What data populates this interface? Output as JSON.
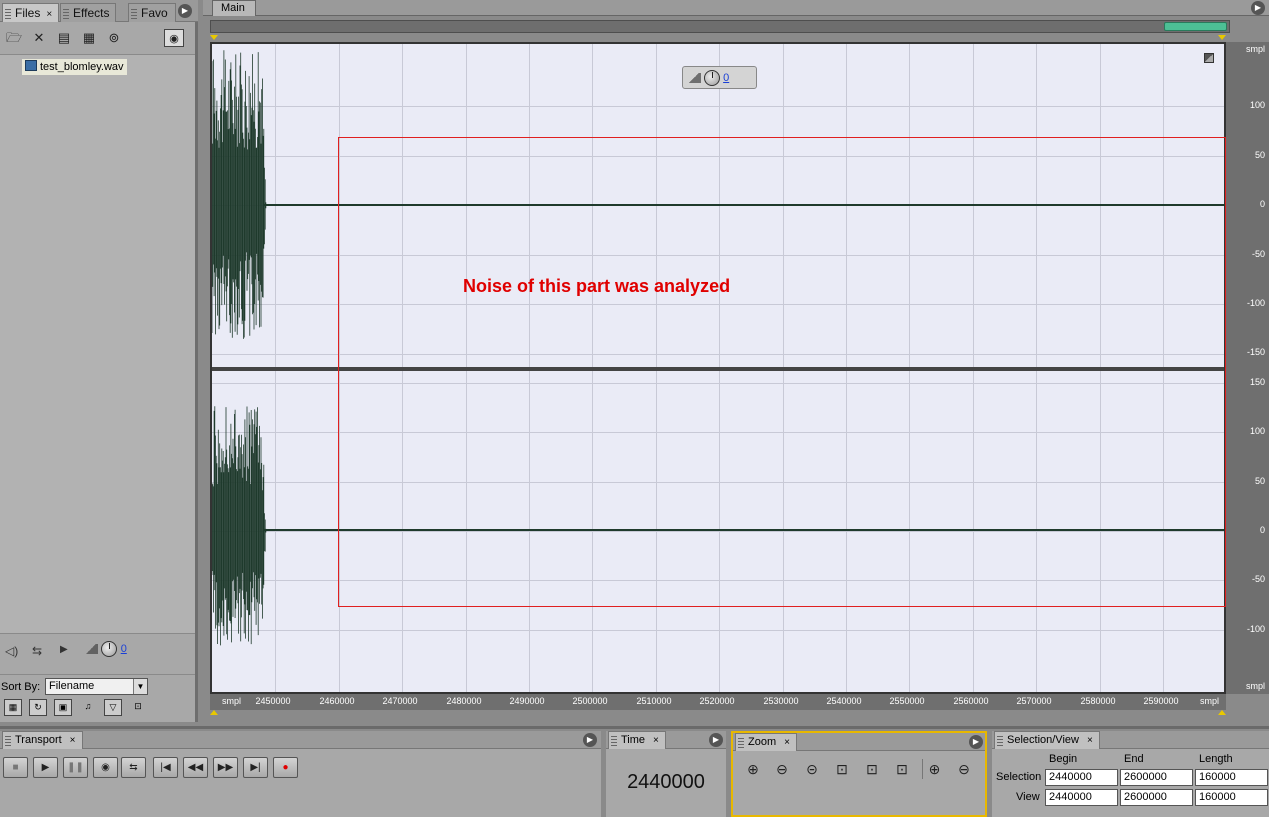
{
  "left_panel": {
    "tabs": [
      {
        "label": "Files",
        "close": "×"
      },
      {
        "label": "Effects",
        "close": ""
      },
      {
        "label": "Favo",
        "close": ""
      }
    ],
    "files": [
      {
        "name": "test_blomley.wav"
      }
    ],
    "volume_value": "0",
    "sort_by_label": "Sort By:",
    "sort_by_value": "Filename"
  },
  "main": {
    "tab_label": "Main",
    "volume_value": "0",
    "annotation": "Noise of this part was analyzed",
    "amplitude_unit": "smpl",
    "amplitude_ticks_ch1": [
      "100",
      "50",
      "0",
      "-50",
      "-100",
      "-150"
    ],
    "amplitude_ticks_ch2": [
      "150",
      "100",
      "50",
      "0",
      "-50",
      "-100"
    ],
    "time_unit_left": "smpl",
    "time_unit_right": "smpl",
    "time_ticks": [
      "2450000",
      "2460000",
      "2470000",
      "2480000",
      "2490000",
      "2500000",
      "2510000",
      "2520000",
      "2530000",
      "2540000",
      "2550000",
      "2560000",
      "2570000",
      "2580000",
      "2590000"
    ],
    "waveform_color": "#1f3a2c",
    "selection_color": "#e01f1f"
  },
  "transport": {
    "label": "Transport",
    "close": "×"
  },
  "time_panel": {
    "label": "Time",
    "close": "×",
    "value": "2440000"
  },
  "zoom_panel": {
    "label": "Zoom",
    "close": "×"
  },
  "selection_view": {
    "label": "Selection/View",
    "close": "×",
    "col_begin": "Begin",
    "col_end": "End",
    "col_length": "Length",
    "row_selection": "Selection",
    "row_view": "View",
    "selection": {
      "begin": "2440000",
      "end": "2600000",
      "length": "160000"
    },
    "view": {
      "begin": "2440000",
      "end": "2600000",
      "length": "160000"
    }
  }
}
